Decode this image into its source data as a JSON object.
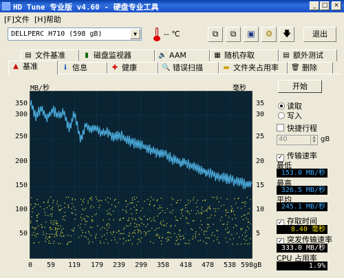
{
  "window": {
    "title": "HD Tune 专业版 v4.60 - 硬盘专业工具"
  },
  "menu": {
    "file": "[F]文件",
    "help": "[H]帮助"
  },
  "toolbar": {
    "drive": "DELLPERC H710 (598 gB)",
    "temperature": "-- ℃",
    "exit_label": "退出"
  },
  "tabs_top": [
    "文件基准",
    "磁盘监视器",
    "AAM",
    "随机存取",
    "额外测试"
  ],
  "tabs_bottom": [
    "基准",
    "信息",
    "健康",
    "错误扫描",
    "文件夹占用率",
    "删除"
  ],
  "graph": {
    "left_unit": "MB/秒",
    "right_unit": "毫秒",
    "y_left_ticks": [
      "350",
      "300",
      "250",
      "200",
      "150",
      "100",
      "50"
    ],
    "y_right_ticks": [
      "35",
      "30",
      "25",
      "20",
      "15",
      "10",
      "5"
    ],
    "x_ticks": [
      "0",
      "59",
      "119",
      "179",
      "239",
      "299",
      "358",
      "418",
      "478",
      "538",
      "598gB"
    ]
  },
  "chart_data": {
    "type": "line",
    "x_unit": "gB",
    "xlim": [
      0,
      598
    ],
    "ylim_left": [
      0,
      350
    ],
    "ylim_right": [
      0,
      35
    ],
    "series": [
      {
        "values_x": [
          0,
          15,
          30,
          45,
          60,
          75,
          90,
          105,
          119,
          135,
          150,
          165,
          179,
          195,
          210,
          225,
          239,
          255,
          270,
          285,
          299,
          315,
          330,
          345,
          358,
          375,
          390,
          405,
          418,
          435,
          450,
          465,
          478,
          495,
          510,
          525,
          538,
          555,
          570,
          585,
          598
        ],
        "values_y": [
          325,
          300,
          315,
          295,
          310,
          300,
          305,
          270,
          305,
          250,
          280,
          270,
          275,
          262,
          265,
          255,
          260,
          252,
          245,
          240,
          238,
          232,
          225,
          220,
          222,
          212,
          205,
          200,
          202,
          195,
          188,
          185,
          180,
          175,
          172,
          168,
          165,
          160,
          158,
          154,
          155
        ]
      }
    ]
  },
  "controls": {
    "start_label": "开始",
    "read_label": "读取",
    "write_label": "写入",
    "short_stroke_label": "快捷行程",
    "short_stroke_value": "40",
    "short_stroke_unit": "gB",
    "transfer_rate_label": "传输速率",
    "min_label": "最低",
    "min_value": "153.0 MB/秒",
    "max_label": "最高",
    "max_value": "326.5 MB/秒",
    "avg_label": "平均",
    "avg_value": "245.1 MB/秒",
    "access_time_label": "存取时间",
    "access_time_value": "8.40 毫秒",
    "burst_rate_label": "突发传输速率",
    "burst_rate_value": "333.0 MB/秒",
    "cpu_label": "CPU 占用率",
    "cpu_value": "1.9%"
  },
  "colors": {
    "graph_bg": "#0a2434",
    "line": "#4aa8d8",
    "scatter": "#d8d040",
    "stat_blue": "#3aa8ff",
    "stat_yellow": "#e8d800"
  }
}
